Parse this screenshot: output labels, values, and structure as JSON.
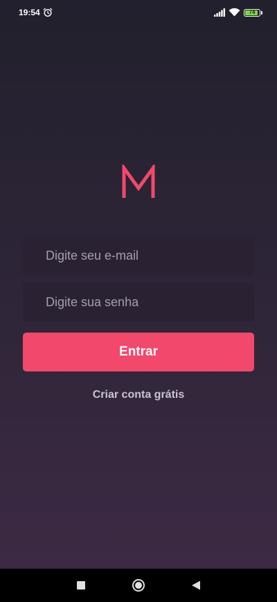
{
  "status_bar": {
    "time": "19:54",
    "battery_level": "74",
    "icons": [
      "alarm-icon",
      "signal-icon",
      "wifi-icon",
      "battery-icon"
    ]
  },
  "login": {
    "email_placeholder": "Digite seu e-mail",
    "password_placeholder": "Digite sua senha",
    "submit_label": "Entrar",
    "create_account_label": "Criar conta grátis"
  },
  "nav_bar": {
    "icons": [
      "recents-icon",
      "home-icon",
      "back-icon"
    ]
  },
  "colors": {
    "accent": "#f2486b",
    "background_top": "#22202d",
    "background_bottom": "#3e2a45",
    "input_background": "#2a2233",
    "battery": "#7cdc3c"
  }
}
